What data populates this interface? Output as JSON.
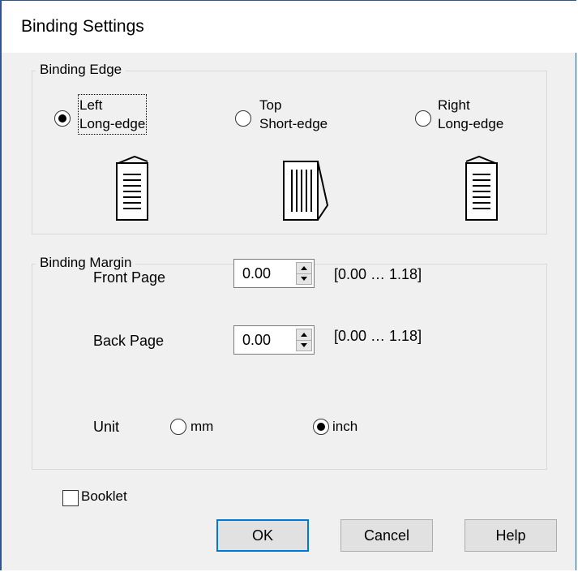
{
  "window": {
    "title": "Binding Settings"
  },
  "binding_edge": {
    "legend": "Binding Edge",
    "options": [
      {
        "line1": "Left",
        "line2": "Long-edge",
        "selected": true,
        "icon": "document-left-binding-icon"
      },
      {
        "line1": "Top",
        "line2": "Short-edge",
        "selected": false,
        "icon": "document-top-binding-icon"
      },
      {
        "line1": "Right",
        "line2": "Long-edge",
        "selected": false,
        "icon": "document-right-binding-icon"
      }
    ]
  },
  "binding_margin": {
    "legend": "Binding Margin",
    "front_page": {
      "label": "Front Page",
      "value": "0.00",
      "range": "[0.00 … 1.18]"
    },
    "back_page": {
      "label": "Back Page",
      "value": "0.00",
      "range": "[0.00 … 1.18]"
    },
    "unit": {
      "label": "Unit",
      "options": [
        {
          "label": "mm",
          "selected": false
        },
        {
          "label": "inch",
          "selected": true
        }
      ]
    }
  },
  "booklet": {
    "label": "Booklet",
    "checked": false
  },
  "buttons": {
    "ok": "OK",
    "cancel": "Cancel",
    "help": "Help"
  },
  "colors": {
    "accent": "#0078d7",
    "window_border": "#2b5797",
    "dialog_bg": "#f0f0f0"
  }
}
